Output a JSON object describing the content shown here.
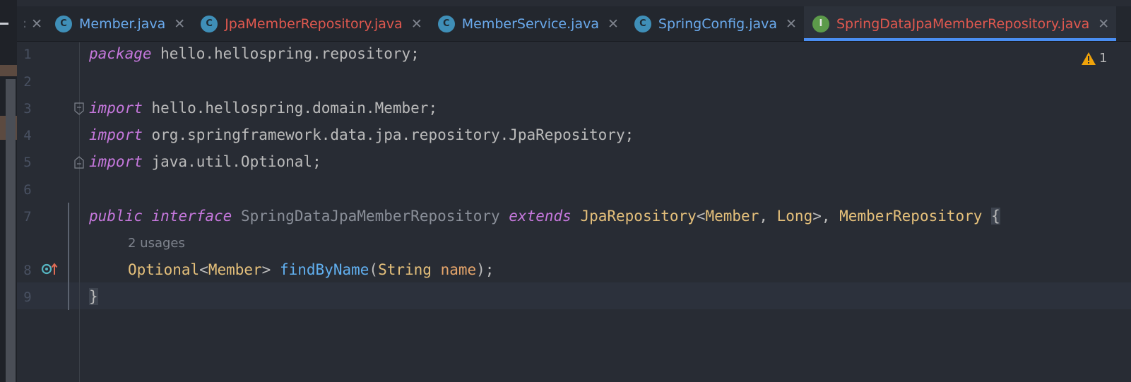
{
  "tabs": [
    {
      "label": "Member.java",
      "icon": "class-icon",
      "icon_letter": "C",
      "color": "#6aaaed",
      "active": false
    },
    {
      "label": "JpaMemberRepository.java",
      "icon": "class-icon",
      "icon_letter": "C",
      "color": "#e0584f",
      "active": false
    },
    {
      "label": "MemberService.java",
      "icon": "class-icon",
      "icon_letter": "C",
      "color": "#6aaaed",
      "active": false
    },
    {
      "label": "SpringConfig.java",
      "icon": "class-icon",
      "icon_letter": "C",
      "color": "#6aaaed",
      "active": false
    },
    {
      "label": "SpringDataJpaMemberRepository.java",
      "icon": "interface-icon",
      "icon_letter": "I",
      "color": "#e0584f",
      "active": true
    }
  ],
  "editor": {
    "line_numbers": [
      "1",
      "2",
      "3",
      "4",
      "5",
      "6",
      "7",
      "8",
      "9"
    ],
    "line1": {
      "kw": "package",
      "rest": " hello.hellospring.repository;"
    },
    "line3": {
      "kw": "import",
      "rest": " hello.hellospring.domain.Member;"
    },
    "line4": {
      "kw": "import",
      "rest": " org.springframework.data.jpa.repository.JpaRepository;"
    },
    "line5": {
      "kw": "import",
      "rest": " java.util.Optional;"
    },
    "line7": {
      "kw1": "public",
      "kw2": "interface",
      "name": "SpringDataJpaMemberRepository",
      "kw3": "extends",
      "type1": "JpaRepository",
      "lt": "<",
      "type2": "Member",
      "comma": ", ",
      "type3": "Long",
      "gt": ">, ",
      "type4": "MemberRepository",
      "brace": "{"
    },
    "usages_hint": "2 usages",
    "line8": {
      "type1": "Optional",
      "lt": "<",
      "type2": "Member",
      "gt": "> ",
      "method": "findByName",
      "open": "(",
      "ptype": "String",
      "pname": "name",
      "close": ");"
    },
    "line9": {
      "brace": "}"
    },
    "warning_count": "1"
  },
  "colors": {
    "keyword": "#c678dd",
    "type": "#e5c07b",
    "method": "#61afef",
    "active_tab_underline": "#4a8ef2",
    "warning": "#f0a30a"
  }
}
